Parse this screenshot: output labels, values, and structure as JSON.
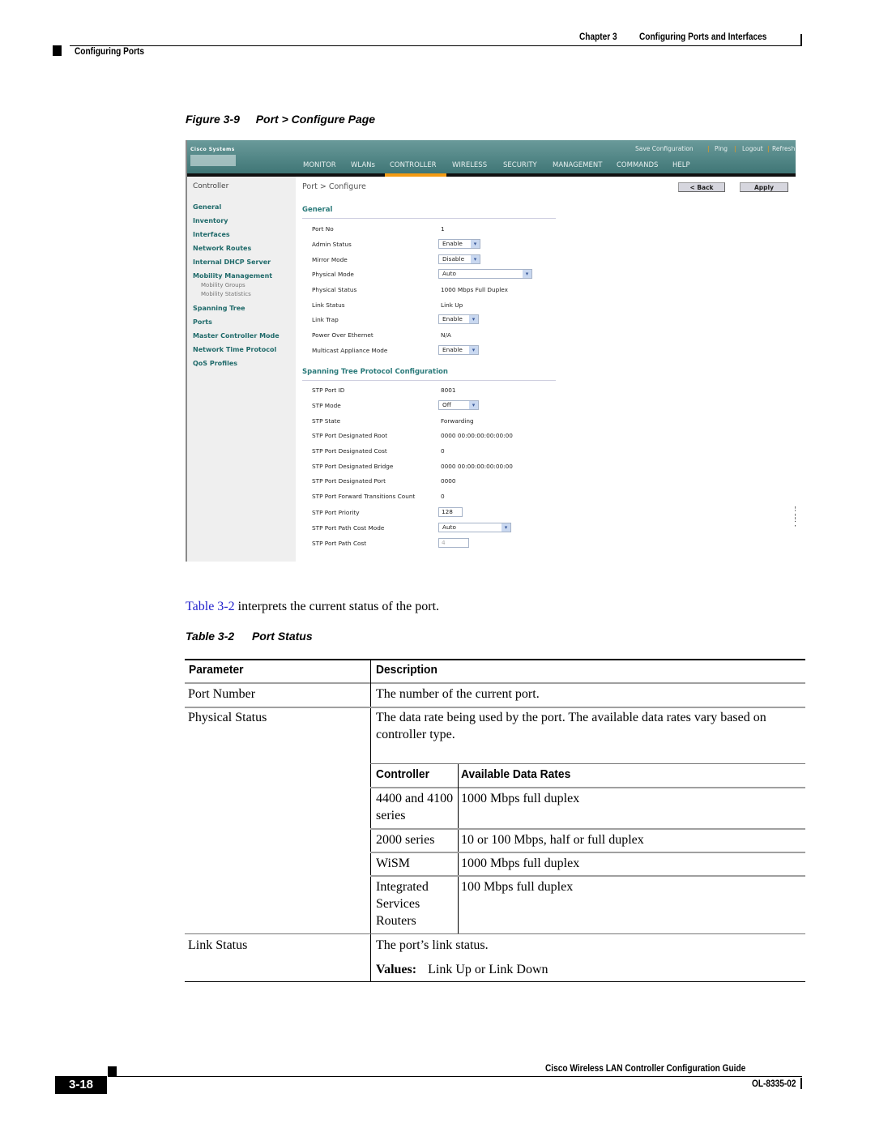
{
  "header": {
    "chapter": "Chapter 3",
    "chapter_title": "Configuring Ports and Interfaces",
    "section": "Configuring Ports"
  },
  "figure": {
    "number": "Figure 3-9",
    "title": "Port > Configure Page",
    "figure_id": "146946"
  },
  "app": {
    "logo_text": "Cisco Systems",
    "top_links": [
      "Save Configuration",
      "Ping",
      "Logout",
      "Refresh"
    ],
    "nav": [
      "MONITOR",
      "WLANs",
      "CONTROLLER",
      "WIRELESS",
      "SECURITY",
      "MANAGEMENT",
      "COMMANDS",
      "HELP"
    ],
    "active_nav": "CONTROLLER",
    "accent_color": "#f39a12",
    "sidebar": {
      "title": "Controller",
      "items": [
        "General",
        "Inventory",
        "Interfaces",
        "Network Routes",
        "Internal DHCP Server",
        "Mobility Management"
      ],
      "sub_items": [
        "Mobility Groups",
        "Mobility Statistics"
      ],
      "items_after": [
        "Spanning Tree",
        "Ports",
        "Master Controller Mode",
        "Network Time Protocol",
        "QoS Profiles"
      ]
    },
    "page_title": "Port > Configure",
    "buttons": {
      "back": "< Back",
      "apply": "Apply"
    },
    "general": {
      "title": "General",
      "port_no_label": "Port No",
      "port_no": "1",
      "admin_status_label": "Admin Status",
      "admin_status": "Enable",
      "mirror_mode_label": "Mirror Mode",
      "mirror_mode": "Disable",
      "physical_mode_label": "Physical Mode",
      "physical_mode": "Auto",
      "physical_status_label": "Physical Status",
      "physical_status": "1000 Mbps Full Duplex",
      "link_status_label": "Link Status",
      "link_status": "Link Up",
      "link_trap_label": "Link Trap",
      "link_trap": "Enable",
      "poe_label": "Power Over Ethernet",
      "poe": "N/A",
      "multicast_label": "Multicast Appliance Mode",
      "multicast": "Enable"
    },
    "stp": {
      "title": "Spanning Tree Protocol Configuration",
      "port_id_label": "STP Port ID",
      "port_id": "8001",
      "mode_label": "STP Mode",
      "mode": "Off",
      "state_label": "STP State",
      "state": "Forwarding",
      "des_root_label": "STP Port Designated Root",
      "des_root": "0000 00:00:00:00:00:00",
      "des_cost_label": "STP Port Designated Cost",
      "des_cost": "0",
      "des_bridge_label": "STP Port Designated Bridge",
      "des_bridge": "0000 00:00:00:00:00:00",
      "des_port_label": "STP Port Designated Port",
      "des_port": "0000",
      "fwd_trans_label": "STP Port Forward Transitions Count",
      "fwd_trans": "0",
      "priority_label": "STP Port Priority",
      "priority": "128",
      "path_cost_mode_label": "STP Port Path Cost Mode",
      "path_cost_mode": "Auto",
      "path_cost_label": "STP Port Path Cost",
      "path_cost": "4"
    }
  },
  "body": {
    "intro_link": "Table 3-2",
    "intro_rest": " interprets the current status of the port."
  },
  "table": {
    "number": "Table 3-2",
    "title": "Port Status",
    "headers": [
      "Parameter",
      "Description"
    ],
    "rows": [
      {
        "param": "Port Number",
        "desc": "The number of the current port."
      },
      {
        "param": "Physical Status",
        "desc": "The data rate being used by the port. The available data rates vary based on controller type."
      },
      {
        "param": "Link Status",
        "desc": "The port’s link status.",
        "values_label": "Values:",
        "values": "Link Up or Link Down"
      }
    ],
    "nested": {
      "headers": [
        "Controller",
        "Available Data Rates"
      ],
      "rows": [
        {
          "controller": "4400 and 4100 series",
          "rate": "1000 Mbps full duplex"
        },
        {
          "controller": "2000 series",
          "rate": "10 or 100 Mbps, half or full duplex"
        },
        {
          "controller": "WiSM",
          "rate": "1000 Mbps full duplex"
        },
        {
          "controller": "Integrated Services Routers",
          "rate": "100 Mbps full duplex"
        }
      ]
    }
  },
  "footer": {
    "guide_title": "Cisco Wireless LAN Controller Configuration Guide",
    "page_number": "3-18",
    "doc_number": "OL-8335-02"
  }
}
